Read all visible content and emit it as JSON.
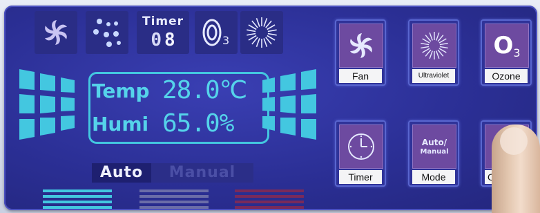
{
  "indicators": {
    "fan_icon": "fan-icon",
    "dots_icon": "dots-icon",
    "timer_label": "Timer",
    "timer_digit_1": "0",
    "timer_digit_2": "8",
    "ozone_icon": "ozone-icon",
    "uv_icon": "ultraviolet-icon"
  },
  "display": {
    "temp_label": "Temp",
    "temp_value": "28.0℃",
    "humi_label": "Humi",
    "humi_value": "65.0%"
  },
  "modes": {
    "auto": "Auto",
    "manual": "Manual"
  },
  "buttons": {
    "fan": "Fan",
    "ultraviolet": "Ultraviolet",
    "ozone": "Ozone",
    "ozone_symbol": "O",
    "ozone_subscript": "3",
    "timer": "Timer",
    "mode_face_line1": "Auto/",
    "mode_face_line2": "Manual",
    "mode": "Mode",
    "power_partial": "O"
  },
  "colors": {
    "panel": "#2b2f95",
    "lcd_cyan": "#55d3ea",
    "button_face": "#6d4aa0",
    "bar_cyan": "#43c7e0",
    "bar_gray": "#6b6da8",
    "bar_red": "#7a2a5a"
  }
}
